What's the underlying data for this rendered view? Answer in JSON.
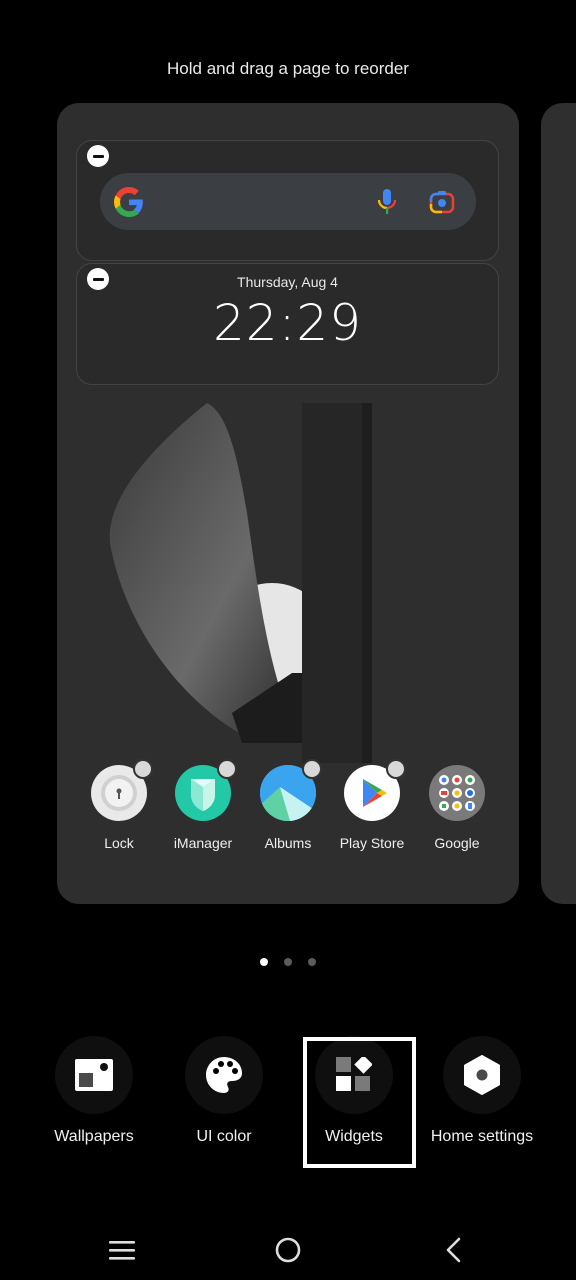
{
  "hint": "Hold and drag a page to reorder",
  "widgets": {
    "search": {
      "name": "Google search bar"
    },
    "clock": {
      "date": "Thursday, Aug 4",
      "time": "22:29"
    }
  },
  "dock_apps": [
    {
      "label": "Lock",
      "icon": "lock-icon"
    },
    {
      "label": "iManager",
      "icon": "shield-icon"
    },
    {
      "label": "Albums",
      "icon": "gallery-icon"
    },
    {
      "label": "Play Store",
      "icon": "play-store-icon"
    },
    {
      "label": "Google",
      "icon": "folder-icon"
    }
  ],
  "page_indicator": {
    "total": 3,
    "current": 1
  },
  "toolbar": [
    {
      "label": "Wallpapers",
      "icon": "wallpaper-icon"
    },
    {
      "label": "UI color",
      "icon": "palette-icon"
    },
    {
      "label": "Widgets",
      "icon": "widgets-icon",
      "focused": true
    },
    {
      "label": "Home settings",
      "icon": "settings-icon"
    }
  ],
  "navbar": {
    "menu": "menu-icon",
    "home": "home-icon",
    "back": "back-icon"
  }
}
